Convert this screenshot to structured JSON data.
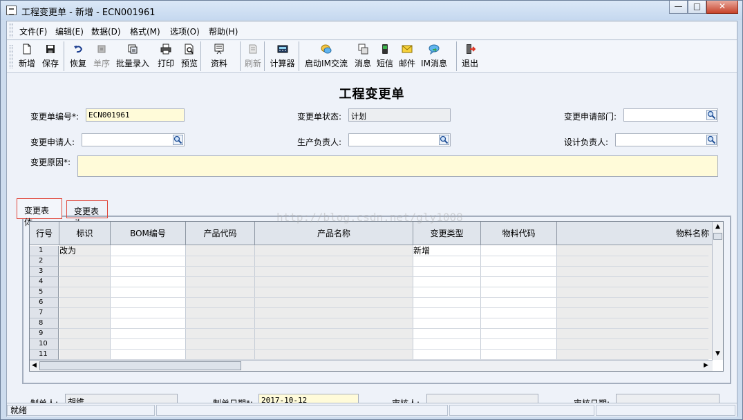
{
  "window": {
    "title": "工程变更单 - 新增 - ECN001961",
    "minimize_glyph": "—",
    "maximize_glyph": "□",
    "close_glyph": "✕"
  },
  "menu": [
    "文件(F)",
    "编辑(E)",
    "数据(D)",
    "格式(M)",
    "选项(O)",
    "帮助(H)"
  ],
  "toolbar": [
    {
      "label": "新增",
      "icon": "new-document-icon",
      "enabled": true
    },
    {
      "label": "保存",
      "icon": "save-icon",
      "enabled": true
    },
    {
      "label": "恢复",
      "icon": "undo-icon",
      "enabled": true
    },
    {
      "label": "单序",
      "icon": "sequence-icon",
      "enabled": false
    },
    {
      "label": "批量录入",
      "icon": "batch-entry-icon",
      "enabled": true
    },
    {
      "label": "打印",
      "icon": "print-icon",
      "enabled": true
    },
    {
      "label": "预览",
      "icon": "preview-icon",
      "enabled": true
    },
    {
      "label": "资料",
      "icon": "data-icon",
      "enabled": true
    },
    {
      "label": "刷新",
      "icon": "refresh-icon",
      "enabled": false
    },
    {
      "label": "计算器",
      "icon": "calculator-icon",
      "enabled": true
    },
    {
      "label": "启动IM交流",
      "icon": "im-chat-icon",
      "enabled": true
    },
    {
      "label": "消息",
      "icon": "message-icon",
      "enabled": true
    },
    {
      "label": "短信",
      "icon": "sms-icon",
      "enabled": true
    },
    {
      "label": "邮件",
      "icon": "mail-icon",
      "enabled": true
    },
    {
      "label": "IM消息",
      "icon": "im-message-icon",
      "enabled": true
    },
    {
      "label": "退出",
      "icon": "exit-icon",
      "enabled": true
    }
  ],
  "form": {
    "title": "工程变更单",
    "change_no_label": "变更单编号*:",
    "change_no_value": "ECN001961",
    "status_label": "变更单状态:",
    "status_value": "计划",
    "dept_label": "变更申请部门:",
    "dept_value": "",
    "applicant_label": "变更申请人:",
    "applicant_value": "",
    "prod_owner_label": "生产负责人:",
    "prod_owner_value": "",
    "design_owner_label": "设计负责人:",
    "design_owner_value": "",
    "reason_label": "变更原因*:",
    "reason_value": ""
  },
  "tabs": [
    "变更表体",
    "变更表头"
  ],
  "grid": {
    "columns": [
      "行号",
      "标识",
      "BOM编号",
      "产品代码",
      "产品名称",
      "变更类型",
      "物料代码",
      "物料名称"
    ],
    "rows": [
      [
        "1",
        "改为",
        "",
        "",
        "",
        "新增",
        "",
        ""
      ],
      [
        "2",
        "",
        "",
        "",
        "",
        "",
        "",
        ""
      ],
      [
        "3",
        "",
        "",
        "",
        "",
        "",
        "",
        ""
      ],
      [
        "4",
        "",
        "",
        "",
        "",
        "",
        "",
        ""
      ],
      [
        "5",
        "",
        "",
        "",
        "",
        "",
        "",
        ""
      ],
      [
        "6",
        "",
        "",
        "",
        "",
        "",
        "",
        ""
      ],
      [
        "7",
        "",
        "",
        "",
        "",
        "",
        "",
        ""
      ],
      [
        "8",
        "",
        "",
        "",
        "",
        "",
        "",
        ""
      ],
      [
        "9",
        "",
        "",
        "",
        "",
        "",
        "",
        ""
      ],
      [
        "10",
        "",
        "",
        "",
        "",
        "",
        "",
        ""
      ],
      [
        "11",
        "",
        "",
        "",
        "",
        "",
        "",
        ""
      ]
    ],
    "watermark": "http://blog.csdn.net/gly1008"
  },
  "footer": {
    "maker_label": "制单人:",
    "maker_value": "胡维",
    "date_label": "制单日期*:",
    "date_value": "2017-10-12",
    "auditor_label": "审核人:",
    "auditor_value": "",
    "audit_date_label": "审核日期:",
    "audit_date_value": ""
  },
  "status": {
    "text": "就绪"
  }
}
